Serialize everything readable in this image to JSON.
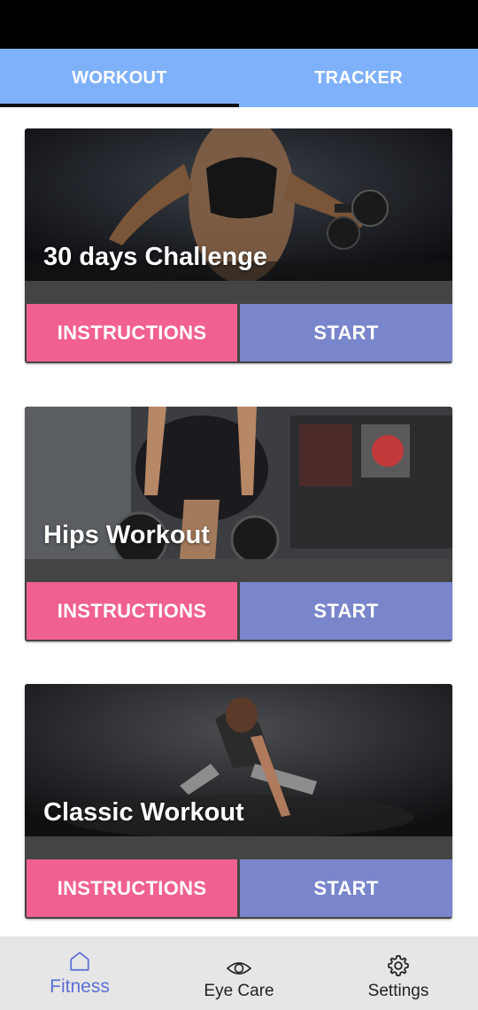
{
  "tabs": [
    {
      "label": "WORKOUT",
      "active": true
    },
    {
      "label": "TRACKER",
      "active": false
    }
  ],
  "cards": [
    {
      "title": "30 days Challenge",
      "instructions_label": "INSTRUCTIONS",
      "start_label": "START"
    },
    {
      "title": "Hips Workout",
      "instructions_label": "INSTRUCTIONS",
      "start_label": "START"
    },
    {
      "title": "Classic Workout",
      "instructions_label": "INSTRUCTIONS",
      "start_label": "START"
    }
  ],
  "bottom_nav": [
    {
      "label": "Fitness",
      "icon": "home-icon",
      "active": true
    },
    {
      "label": "Eye Care",
      "icon": "eye-icon",
      "active": false
    },
    {
      "label": "Settings",
      "icon": "gear-icon",
      "active": false
    }
  ],
  "colors": {
    "tab_bar": "#7fb1fb",
    "instructions_button": "#f06090",
    "start_button": "#7986cb",
    "active_nav": "#5a6ed6"
  }
}
